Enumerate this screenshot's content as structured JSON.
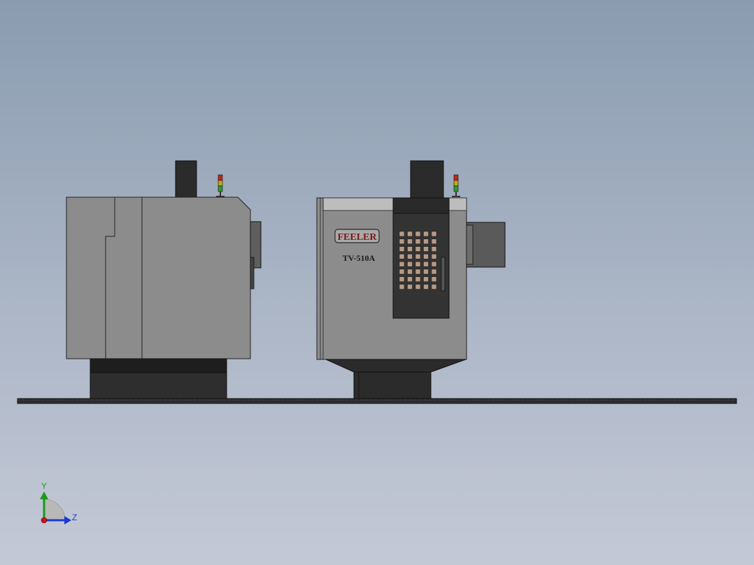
{
  "viewport": {
    "background_top": "#8a9bb0",
    "background_bottom": "#c4c9d6"
  },
  "machine_front": {
    "brand_label": "FEELER",
    "model_label": "TV-510A",
    "brand_color": "#7a1a14"
  },
  "colors": {
    "enclosure": "#8c8c8c",
    "enclosure_light": "#bdbdbd",
    "dark": "#2b2b2b",
    "floor": "#2e2e2e",
    "panel": "#333333",
    "panel_key": "#b89a86",
    "light_red": "#c0281e",
    "light_yellow": "#c8a414",
    "light_green": "#2f9a2f"
  },
  "triad": {
    "y_label": "Y",
    "z_label": "Z",
    "y_color": "#1a9a1a",
    "z_color": "#1a3ad0",
    "x_color": "#c01818"
  }
}
